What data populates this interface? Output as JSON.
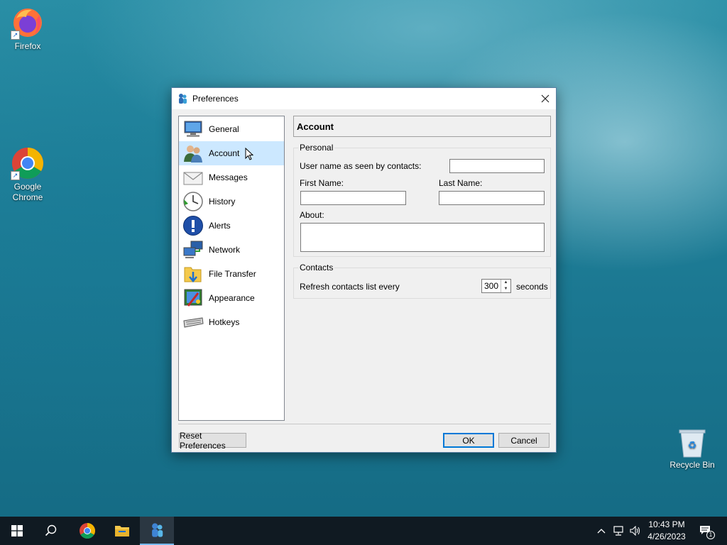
{
  "desktop": {
    "icons": [
      {
        "label": "Firefox"
      },
      {
        "label": "Google Chrome"
      },
      {
        "label": "Recycle Bin"
      }
    ]
  },
  "dialog": {
    "title": "Preferences",
    "nav": [
      {
        "label": "General",
        "icon": "monitor-icon"
      },
      {
        "label": "Account",
        "icon": "users-icon"
      },
      {
        "label": "Messages",
        "icon": "envelope-icon"
      },
      {
        "label": "History",
        "icon": "clock-icon"
      },
      {
        "label": "Alerts",
        "icon": "info-icon"
      },
      {
        "label": "Network",
        "icon": "network-icon"
      },
      {
        "label": "File Transfer",
        "icon": "folder-icon"
      },
      {
        "label": "Appearance",
        "icon": "paint-icon"
      },
      {
        "label": "Hotkeys",
        "icon": "keyboard-icon"
      }
    ],
    "selected_nav": "Account",
    "panel_title": "Account",
    "personal": {
      "group_label": "Personal",
      "username_label": "User name as seen by contacts:",
      "username_value": "",
      "first_name_label": "First Name:",
      "first_name_value": "",
      "last_name_label": "Last Name:",
      "last_name_value": "",
      "about_label": "About:",
      "about_value": ""
    },
    "contacts": {
      "group_label": "Contacts",
      "refresh_label": "Refresh contacts list every",
      "refresh_value": "300",
      "unit_label": "seconds"
    },
    "buttons": {
      "reset": "Reset Preferences",
      "ok": "OK",
      "cancel": "Cancel"
    }
  },
  "taskbar": {
    "time": "10:43 PM",
    "date": "4/26/2023",
    "notification_count": "1"
  },
  "colors": {
    "selection": "#cce8ff",
    "accent": "#0078d7",
    "taskbar": "#101a22"
  }
}
